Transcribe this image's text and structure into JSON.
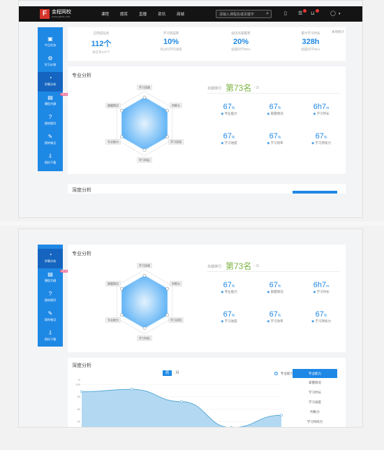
{
  "app": {
    "logo_letter": "F",
    "logo_name": "金程网校",
    "logo_sub": "www.gfedu.net"
  },
  "nav": [
    "课程",
    "题库",
    "直播",
    "资讯",
    "商城"
  ],
  "search": {
    "placeholder": "请输入课程名或关键字"
  },
  "sidebar": [
    {
      "label": "今日任务",
      "icon": "calendar-icon"
    },
    {
      "label": "学习计划",
      "icon": "plan-icon"
    },
    {
      "label": "学情分析",
      "icon": "analysis-icon"
    },
    {
      "label": "课程大纲",
      "icon": "outline-icon",
      "badge": "NEW"
    },
    {
      "label": "我的提问",
      "icon": "question-icon"
    },
    {
      "label": "我的笔记",
      "icon": "pen-icon"
    },
    {
      "label": "资料下载",
      "icon": "download-icon"
    }
  ],
  "stats": [
    {
      "title": "已完成任务",
      "value": "112个",
      "sub": "总任务127个"
    },
    {
      "title": "学习完成率",
      "value": "10%",
      "sub": "高过同学的进度"
    },
    {
      "title": "知识点掌握率",
      "value": "20%",
      "sub": "超越同学55%"
    },
    {
      "title": "累计学习时长",
      "value": "328h",
      "sub": "超越同学56%"
    }
  ],
  "stats_more": "本周统计",
  "professional": {
    "title": "专业分析",
    "rank_label": "本期排行:",
    "rank_value": "第73名",
    "rank_change": "↑ 3↑",
    "radar_labels": [
      "学习进度",
      "判断力",
      "学习成效",
      "学习特征",
      "专业能力",
      "掌握情况"
    ],
    "metrics": [
      {
        "value": "67",
        "unit": "%",
        "label": "专业能力"
      },
      {
        "value": "67",
        "unit": "%",
        "label": "掌握情况"
      },
      {
        "value": "6h7",
        "unit": "m",
        "label": "学习时长"
      },
      {
        "value": "67",
        "unit": "%",
        "label": "学习进度"
      },
      {
        "value": "67",
        "unit": "%",
        "label": "学习效率"
      },
      {
        "value": "67",
        "unit": "%",
        "label": "学习持续力"
      }
    ]
  },
  "depth": {
    "title": "深度分析",
    "toggle_on": "周",
    "toggle_off": "月",
    "legend": "专业能力",
    "list": [
      "专业能力",
      "掌握情况",
      "学习时长",
      "学习进度",
      "判断力",
      "学习持续力"
    ],
    "y_label": "%",
    "y_ticks": [
      "100",
      "80",
      "60",
      "40"
    ]
  },
  "chart_data": {
    "type": "area",
    "series": [
      {
        "name": "专业能力",
        "values": [
          88,
          92,
          72,
          30,
          50
        ]
      }
    ],
    "ylabel": "%",
    "ylim": [
      30,
      100
    ],
    "grid": true,
    "legend_placement": "top-right"
  },
  "colors": {
    "accent": "#1e88e5",
    "rank": "#7cb342",
    "topbar": "#141414"
  }
}
